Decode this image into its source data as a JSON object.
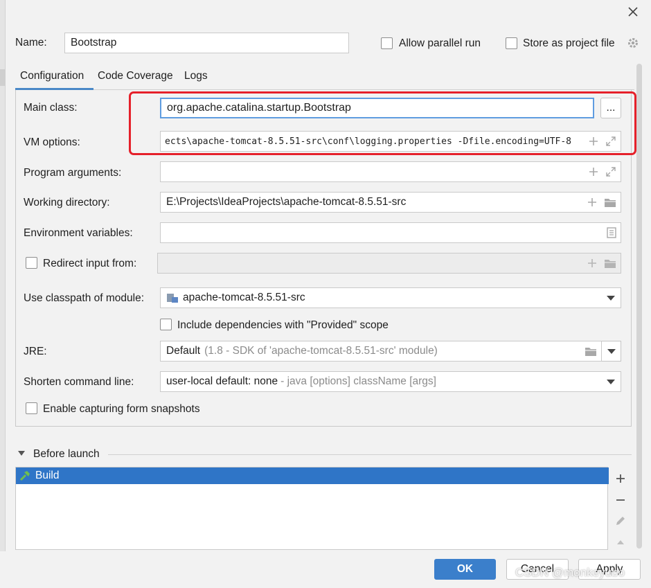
{
  "dialog": {
    "name_label": "Name:",
    "name_value": "Bootstrap",
    "allow_parallel_run": "Allow parallel run",
    "store_as_project_file": "Store as project file"
  },
  "tabs": [
    {
      "label": "Configuration",
      "active": true
    },
    {
      "label": "Code Coverage",
      "active": false
    },
    {
      "label": "Logs",
      "active": false
    }
  ],
  "form": {
    "main_class_label": "Main class:",
    "main_class_value": "org.apache.catalina.startup.Bootstrap",
    "browse_label": "...",
    "vm_options_label": "VM options:",
    "vm_options_value": "ects\\apache-tomcat-8.5.51-src\\conf\\logging.properties -Dfile.encoding=UTF-8",
    "program_arguments_label": "Program arguments:",
    "program_arguments_value": "",
    "working_directory_label": "Working directory:",
    "working_directory_value": "E:\\Projects\\IdeaProjects\\apache-tomcat-8.5.51-src",
    "environment_variables_label": "Environment variables:",
    "environment_variables_value": "",
    "redirect_input_label": "Redirect input from:",
    "classpath_module_label": "Use classpath of module:",
    "classpath_module_value": "apache-tomcat-8.5.51-src",
    "include_dependencies_label": "Include dependencies with \"Provided\" scope",
    "jre_label": "JRE:",
    "jre_value": "Default",
    "jre_hint": "(1.8 - SDK of 'apache-tomcat-8.5.51-src' module)",
    "shorten_label": "Shorten command line:",
    "shorten_value": "user-local default: none",
    "shorten_hint": "- java [options] className [args]",
    "enable_snapshots_label": "Enable capturing form snapshots"
  },
  "before_launch": {
    "title": "Before launch",
    "items": [
      {
        "label": "Build"
      }
    ]
  },
  "buttons": {
    "ok": "OK",
    "cancel": "Cancel",
    "apply": "Apply"
  },
  "watermark": "CSDN @monkeyubo",
  "colors": {
    "accent": "#3b7fcb",
    "highlight_box": "#e5202a",
    "selection": "#2f75c7"
  }
}
